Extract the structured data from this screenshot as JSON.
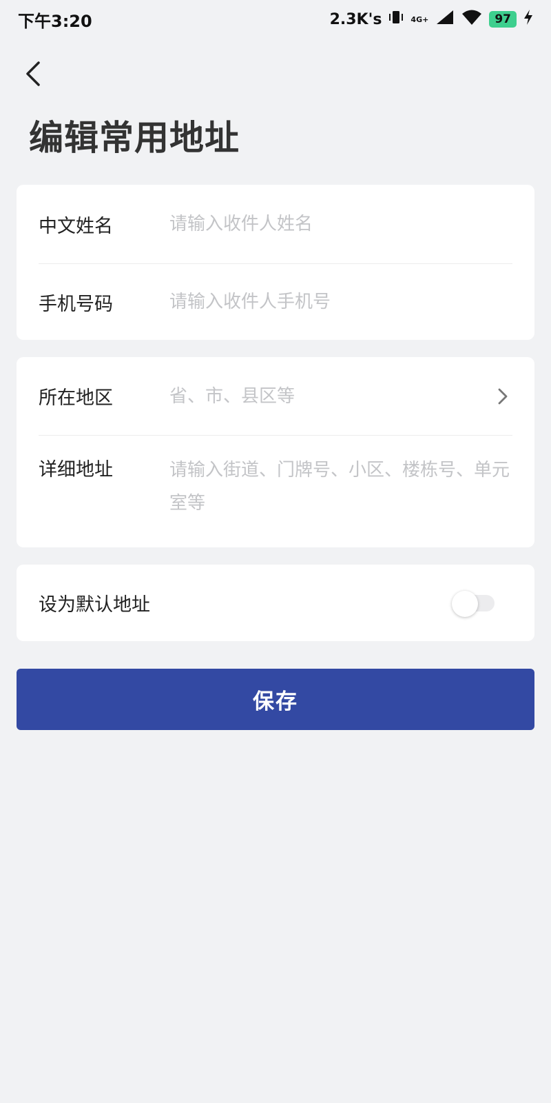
{
  "status_bar": {
    "time": "下午3:20",
    "net_speed": "2.3K's",
    "signal_label": "4G+",
    "battery": "97"
  },
  "page": {
    "title": "编辑常用地址"
  },
  "contact": {
    "name_label": "中文姓名",
    "name_placeholder": "请输入收件人姓名",
    "phone_label": "手机号码",
    "phone_placeholder": "请输入收件人手机号"
  },
  "address": {
    "region_label": "所在地区",
    "region_placeholder": "省、市、县区等",
    "detail_label": "详细地址",
    "detail_placeholder": "请输入街道、门牌号、小区、楼栋号、单元室等"
  },
  "default_setting": {
    "label": "设为默认地址",
    "enabled": false
  },
  "actions": {
    "save_label": "保存"
  },
  "colors": {
    "accent": "#3349a3",
    "background": "#f1f2f4",
    "battery": "#3ecf8e"
  }
}
